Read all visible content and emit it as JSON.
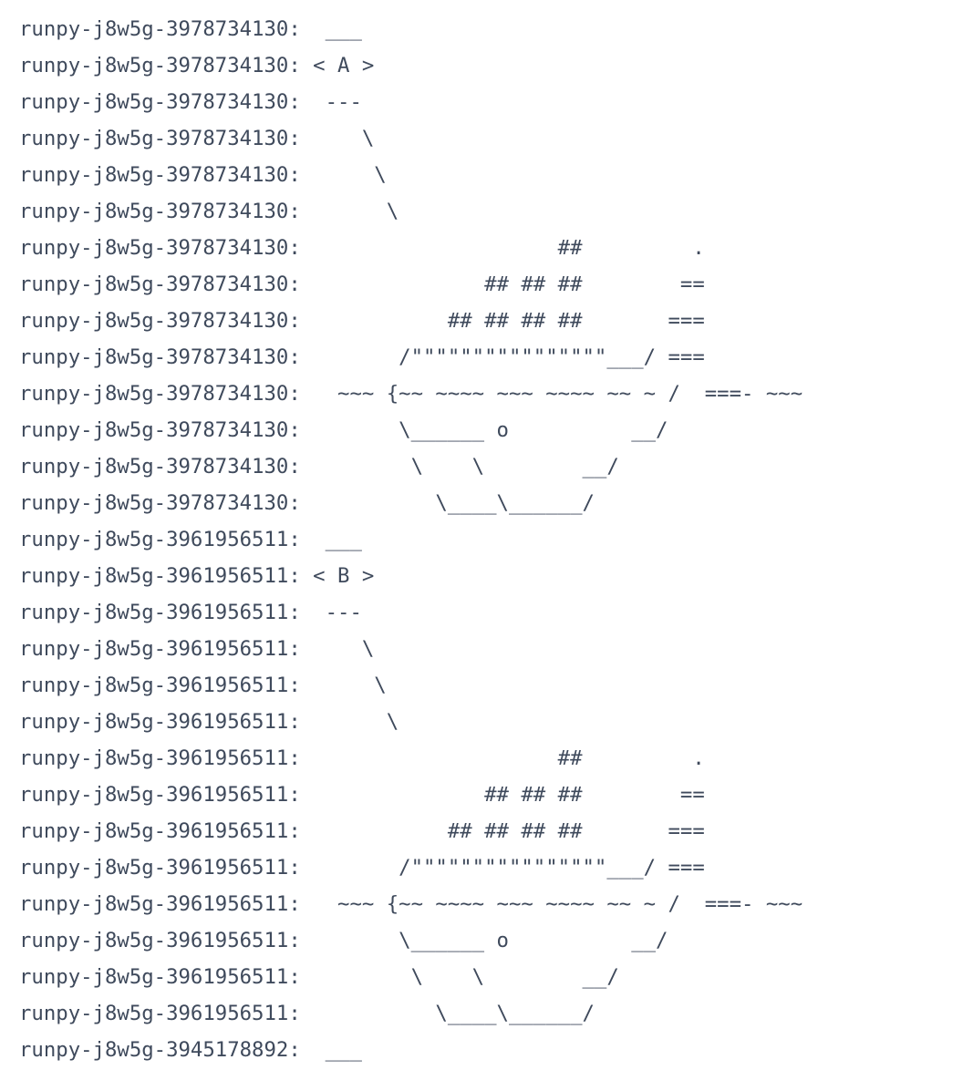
{
  "log": {
    "lines": [
      {
        "prefix": "runpy-j8w5g-3978734130:",
        "text": "  ___"
      },
      {
        "prefix": "runpy-j8w5g-3978734130:",
        "text": " < A >"
      },
      {
        "prefix": "runpy-j8w5g-3978734130:",
        "text": "  ---"
      },
      {
        "prefix": "runpy-j8w5g-3978734130:",
        "text": "     \\"
      },
      {
        "prefix": "runpy-j8w5g-3978734130:",
        "text": "      \\"
      },
      {
        "prefix": "runpy-j8w5g-3978734130:",
        "text": "       \\"
      },
      {
        "prefix": "runpy-j8w5g-3978734130:",
        "text": "                     ##         ."
      },
      {
        "prefix": "runpy-j8w5g-3978734130:",
        "text": "               ## ## ##        =="
      },
      {
        "prefix": "runpy-j8w5g-3978734130:",
        "text": "            ## ## ## ##       ==="
      },
      {
        "prefix": "runpy-j8w5g-3978734130:",
        "text": "        /\"\"\"\"\"\"\"\"\"\"\"\"\"\"\"\"___/ ==="
      },
      {
        "prefix": "runpy-j8w5g-3978734130:",
        "text": "   ~~~ {~~ ~~~~ ~~~ ~~~~ ~~ ~ /  ===- ~~~"
      },
      {
        "prefix": "runpy-j8w5g-3978734130:",
        "text": "        \\______ o          __/"
      },
      {
        "prefix": "runpy-j8w5g-3978734130:",
        "text": "         \\    \\        __/"
      },
      {
        "prefix": "runpy-j8w5g-3978734130:",
        "text": "           \\____\\______/"
      },
      {
        "prefix": "runpy-j8w5g-3961956511:",
        "text": "  ___"
      },
      {
        "prefix": "runpy-j8w5g-3961956511:",
        "text": " < B >"
      },
      {
        "prefix": "runpy-j8w5g-3961956511:",
        "text": "  ---"
      },
      {
        "prefix": "runpy-j8w5g-3961956511:",
        "text": "     \\"
      },
      {
        "prefix": "runpy-j8w5g-3961956511:",
        "text": "      \\"
      },
      {
        "prefix": "runpy-j8w5g-3961956511:",
        "text": "       \\"
      },
      {
        "prefix": "runpy-j8w5g-3961956511:",
        "text": "                     ##         ."
      },
      {
        "prefix": "runpy-j8w5g-3961956511:",
        "text": "               ## ## ##        =="
      },
      {
        "prefix": "runpy-j8w5g-3961956511:",
        "text": "            ## ## ## ##       ==="
      },
      {
        "prefix": "runpy-j8w5g-3961956511:",
        "text": "        /\"\"\"\"\"\"\"\"\"\"\"\"\"\"\"\"___/ ==="
      },
      {
        "prefix": "runpy-j8w5g-3961956511:",
        "text": "   ~~~ {~~ ~~~~ ~~~ ~~~~ ~~ ~ /  ===- ~~~"
      },
      {
        "prefix": "runpy-j8w5g-3961956511:",
        "text": "        \\______ o          __/"
      },
      {
        "prefix": "runpy-j8w5g-3961956511:",
        "text": "         \\    \\        __/"
      },
      {
        "prefix": "runpy-j8w5g-3961956511:",
        "text": "           \\____\\______/"
      },
      {
        "prefix": "runpy-j8w5g-3945178892:",
        "text": "  ___"
      }
    ]
  }
}
